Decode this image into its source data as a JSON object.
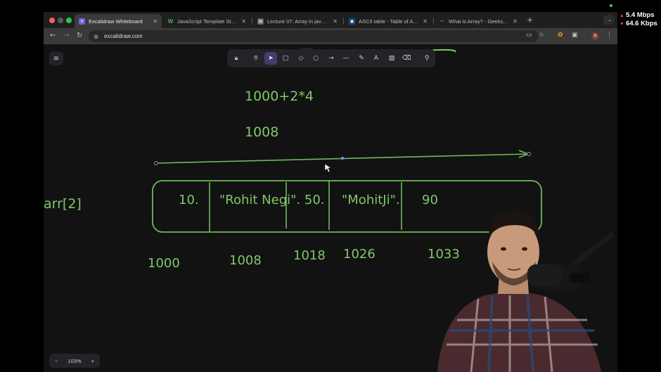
{
  "browser": {
    "tabs": [
      {
        "label": "Excalidraw Whiteboard",
        "active": true,
        "icon": "excalidraw-icon"
      },
      {
        "label": "JavaScript Template Strings",
        "active": false,
        "icon": "w3schools-icon"
      },
      {
        "label": "Lecture 07: Array in javascrip",
        "active": false,
        "icon": "doc-icon"
      },
      {
        "label": "ASCII table - Table of ASCII c",
        "active": false,
        "icon": "ascii-icon"
      },
      {
        "label": "What is Array? - GeeksforGee",
        "active": false,
        "icon": "gfg-icon"
      }
    ],
    "url": "excalidraw.com",
    "profile_initial": "R"
  },
  "network": {
    "upload": "5.4 Mbps",
    "download": "64.6 Kbps"
  },
  "whiteboard": {
    "expression": "1000+2*4",
    "result": "1008",
    "array_label": "arr[2]",
    "cells": [
      "10.",
      "\"Rohit Negi\". 50.",
      "\"MohitJi\".",
      "90"
    ],
    "addresses": [
      "1000",
      "1008",
      "1018",
      "1026",
      "1033"
    ],
    "zoom_level": "103%",
    "zoom_out": "−",
    "zoom_in": "+"
  },
  "colors": {
    "ink": "#7ec96a",
    "canvas": "#121212",
    "active_tool": "#403e6a"
  }
}
